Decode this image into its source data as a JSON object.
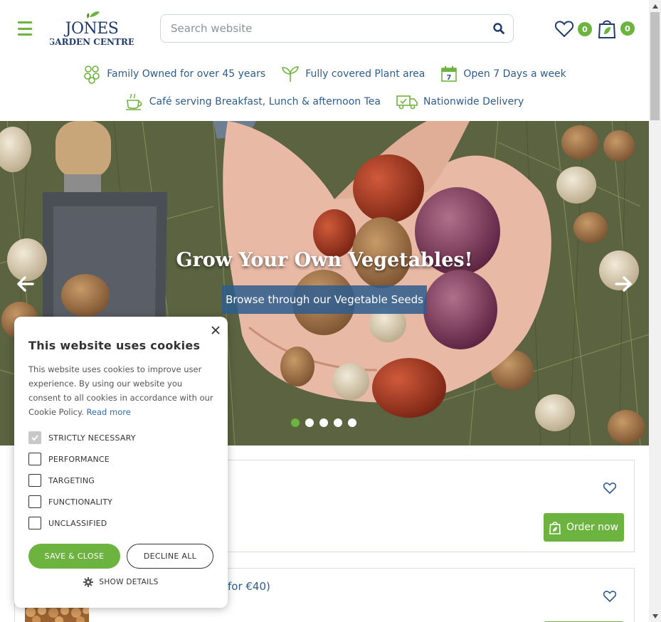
{
  "header": {
    "logo": {
      "line1": "JONES",
      "line2": "GARDEN CENTRE"
    },
    "search": {
      "placeholder": "Search website"
    },
    "wishlist_count": "0",
    "cart_count": "0",
    "usps_row1": [
      {
        "icon": "family-icon",
        "text": "Family Owned for over 45 years"
      },
      {
        "icon": "sprout-icon",
        "text": "Fully covered Plant area"
      },
      {
        "icon": "calendar-icon",
        "text": "Open 7 Days a week",
        "calendar_day": "7"
      }
    ],
    "usps_row2": [
      {
        "icon": "coffee-cup-icon",
        "text": "Café serving Breakfast, Lunch & afternoon Tea"
      },
      {
        "icon": "delivery-truck-icon",
        "text": "Nationwide Delivery"
      }
    ]
  },
  "hero": {
    "title": "Grow Your Own Vegetables!",
    "cta": "Browse through our Vegetable Seeds",
    "slide_count": 5,
    "active_slide": 1
  },
  "products": {
    "order_label": "Order now",
    "card2_text": "for €40)"
  },
  "cookie": {
    "title": "This website uses cookies",
    "body": "This website uses cookies to improve user experience. By using our website you consent to all cookies in accordance with our Cookie Policy.",
    "read_more": "Read more",
    "options": [
      {
        "label": "STRICTLY NECESSARY",
        "checked": true
      },
      {
        "label": "PERFORMANCE",
        "checked": false
      },
      {
        "label": "TARGETING",
        "checked": false
      },
      {
        "label": "FUNCTIONALITY",
        "checked": false
      },
      {
        "label": "UNCLASSIFIED",
        "checked": false
      }
    ],
    "save_label": "SAVE & CLOSE",
    "decline_label": "DECLINE ALL",
    "show_details": "SHOW DETAILS"
  },
  "colors": {
    "brand_green": "#6db33f",
    "brand_blue": "#2e5d8e",
    "navy": "#1f3b6e"
  }
}
